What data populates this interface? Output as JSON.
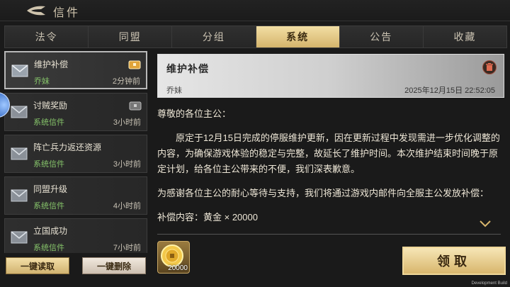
{
  "header": {
    "title": "信件"
  },
  "tabs": [
    {
      "label": "法令",
      "active": false
    },
    {
      "label": "同盟",
      "active": false
    },
    {
      "label": "分组",
      "active": false
    },
    {
      "label": "系统",
      "active": true
    },
    {
      "label": "公告",
      "active": false
    },
    {
      "label": "收藏",
      "active": false
    }
  ],
  "mails": [
    {
      "title": "维护补偿",
      "sender": "乔妹",
      "time": "2分钟前",
      "selected": true,
      "attachment": true
    },
    {
      "title": "讨贼奖励",
      "sender": "系统信件",
      "time": "3小时前",
      "selected": false,
      "attachment": true
    },
    {
      "title": "阵亡兵力返还资源",
      "sender": "系统信件",
      "time": "3小时前",
      "selected": false,
      "attachment": false
    },
    {
      "title": "同盟升级",
      "sender": "系统信件",
      "time": "4小时前",
      "selected": false,
      "attachment": false
    },
    {
      "title": "立国成功",
      "sender": "系统信件",
      "time": "7小时前",
      "selected": false,
      "attachment": false
    }
  ],
  "actions": {
    "read_all": "一键读取",
    "delete_all": "一键删除"
  },
  "detail": {
    "title": "维护补偿",
    "sender": "乔妹",
    "date": "2025年12月15日 22:52:05",
    "greeting": "尊敬的各位主公：",
    "paragraph1": "原定于12月15日完成的停服维护更新，因在更新过程中发现需进一步优化调整的内容，为确保游戏体验的稳定与完整，故延长了维护时间。本次维护结束时间晚于原定计划，给各位主公带来的不便，我们深表歉意。",
    "paragraph2": "为感谢各位主公的耐心等待与支持，我们将通过游戏内邮件向全服主公发放补偿：",
    "paragraph3": "补偿内容：黄金 × 20000",
    "reward_amount": "20000",
    "claim_label": "领取"
  },
  "footer": {
    "dev_build": "Development Build"
  },
  "colors": {
    "accent_gold": "#d8b66d",
    "sender_green": "#86c46a"
  }
}
